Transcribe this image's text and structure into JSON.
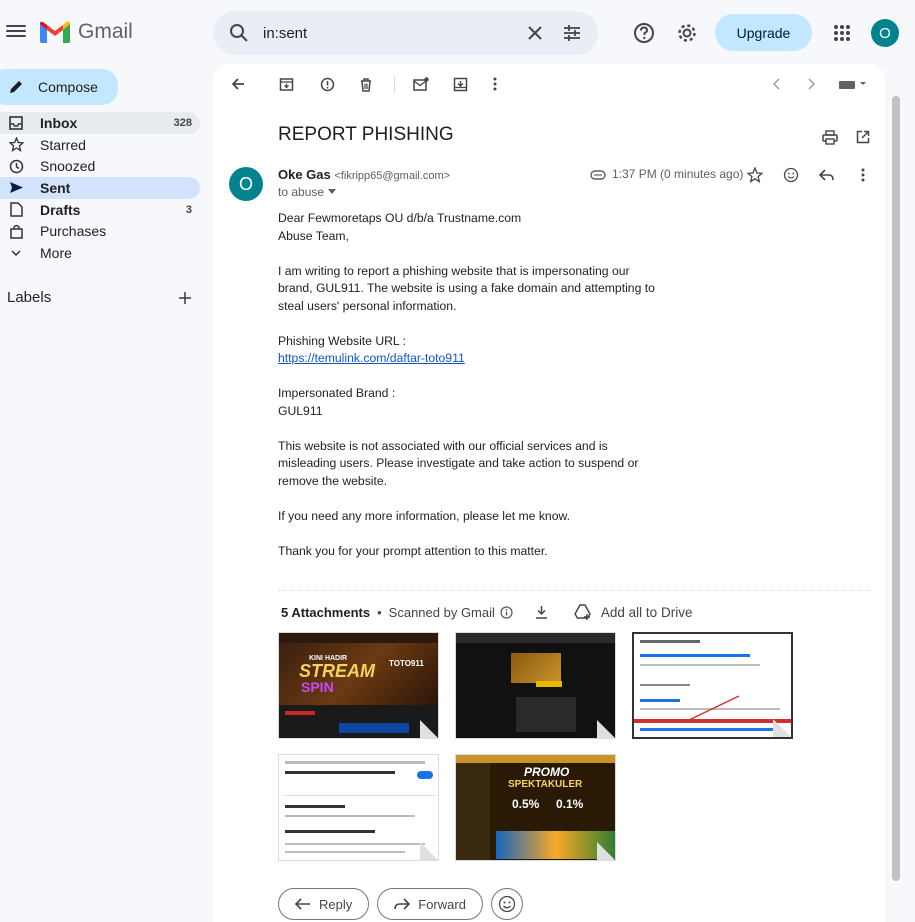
{
  "app": {
    "name": "Gmail"
  },
  "search": {
    "value": "in:sent"
  },
  "header": {
    "upgrade_label": "Upgrade",
    "account_initial": "O"
  },
  "compose": {
    "label": "Compose"
  },
  "nav": [
    {
      "label": "Inbox",
      "count": "328",
      "icon": "inbox-icon"
    },
    {
      "label": "Starred",
      "count": "",
      "icon": "star-icon"
    },
    {
      "label": "Snoozed",
      "count": "",
      "icon": "clock-icon"
    },
    {
      "label": "Sent",
      "count": "",
      "icon": "send-icon"
    },
    {
      "label": "Drafts",
      "count": "3",
      "icon": "draft-icon"
    },
    {
      "label": "Purchases",
      "count": "",
      "icon": "purchases-icon"
    },
    {
      "label": "More",
      "count": "",
      "icon": "chevron-down-icon"
    }
  ],
  "labels": {
    "title": "Labels"
  },
  "message": {
    "subject": "REPORT PHISHING",
    "sender_name": "Oke Gas",
    "sender_email": "<fikripp65@gmail.com>",
    "to": "to abuse",
    "time": "1:37 PM (0 minutes ago)",
    "avatar_initial": "O",
    "body": {
      "p1": "Dear Fewmoretaps OU d/b/a Trustname.com\nAbuse Team,",
      "p2": "I am writing to report a phishing website that is impersonating our brand, GUL911. The website is using a fake domain and attempting to steal users' personal information.",
      "p3_label": "Phishing Website URL :",
      "p3_link": "https://temulink.com/daftar-toto911",
      "p4": "Impersonated Brand :\nGUL911",
      "p5": "This website is not associated with our official services and is misleading users. Please investigate and take action to suspend or remove the website.",
      "p6": "If you need any more information, please let me know.",
      "p7": "Thank you for your prompt attention to this matter."
    }
  },
  "attachments": {
    "count_label": "5 Attachments",
    "scanned_label": "Scanned by Gmail",
    "add_drive_label": "Add all to Drive",
    "thumb1_text": [
      "KINI HADIR",
      "STREAM",
      "SPIN",
      "TOTO911"
    ],
    "thumb5_text": [
      "PROMO",
      "SPEKTAKULER",
      "0.5%",
      "0.1%"
    ]
  },
  "actions": {
    "reply_label": "Reply",
    "forward_label": "Forward"
  },
  "colors": {
    "accent": "#c2e7ff",
    "avatar": "#00838f",
    "sent_active": "#d3e3fd"
  }
}
